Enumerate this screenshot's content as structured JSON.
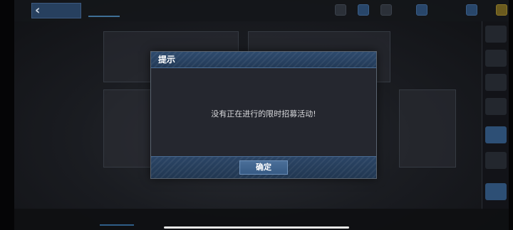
{
  "dialog": {
    "title": "提示",
    "message": "没有正在进行的限时招募活动!",
    "confirm_label": "确定"
  },
  "colors": {
    "header_blue": "#2e4b6e",
    "button_blue": "#4b6f99",
    "dialog_body": "#25272f"
  },
  "icons": {
    "back": "chevron-left-icon"
  }
}
